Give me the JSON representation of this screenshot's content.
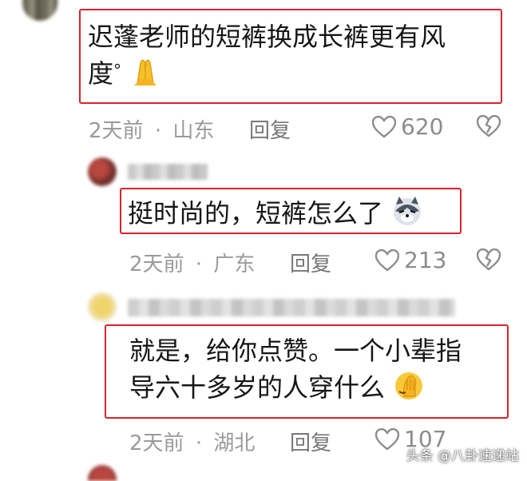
{
  "comments": [
    {
      "text_line1": "迟蓬老师的短裤换成长裤更有风",
      "text_line2": "度",
      "degree_mark": "°",
      "emoji": "folded-hands-emoji",
      "time": "2天前",
      "dot": "·",
      "location": "山东",
      "reply_label": "回复",
      "likes": "620"
    },
    {
      "text_line1": "挺时尚的，短裤怎么了",
      "emoji": "husky-emoji",
      "time": "2天前",
      "dot": "·",
      "location": "广东",
      "reply_label": "回复",
      "likes": "213"
    },
    {
      "text_line1": "就是，给你点赞。一个小辈指",
      "text_line2": "导六十多岁的人穿什么",
      "emoji": "facepalm-emoji",
      "time": "2天前",
      "dot": "·",
      "location": "湖北",
      "reply_label": "回复",
      "likes": "107"
    }
  ],
  "watermark": "头条 @八卦速递站",
  "colors": {
    "highlight_border": "#d8232a",
    "meta_text": "#9a9a9a",
    "reply_text": "#777777"
  }
}
